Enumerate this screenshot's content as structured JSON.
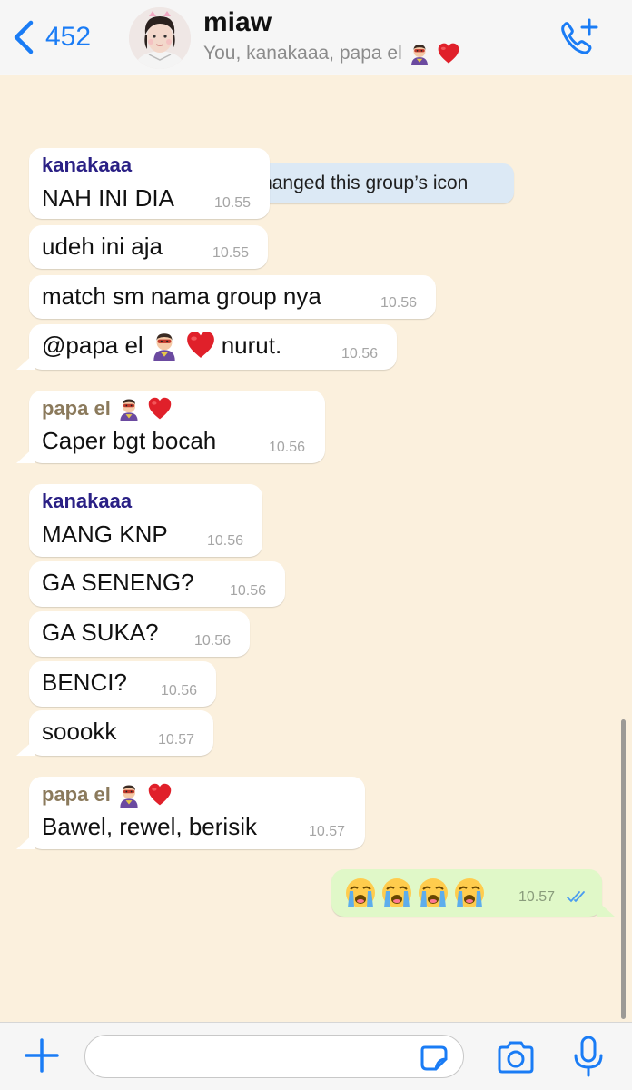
{
  "header": {
    "back_count": "452",
    "title": "miaw",
    "subtitle": "You, kanakaaa, papa el"
  },
  "system_message": "kanakaaa changed this group’s icon",
  "messages": [
    {
      "sender": "kanakaaa",
      "text": "NAH INI DIA",
      "time": "10.55"
    },
    {
      "text": "udeh ini aja",
      "time": "10.55"
    },
    {
      "text": "match sm nama group nya",
      "time": "10.56"
    },
    {
      "text_before": "@papa el",
      "text_after": "nurut.",
      "time": "10.56"
    },
    {
      "sender": "papa el",
      "text": "Caper bgt bocah",
      "time": "10.56"
    },
    {
      "sender": "kanakaaa",
      "text": "MANG KNP",
      "time": "10.56"
    },
    {
      "text": "GA SENENG?",
      "time": "10.56"
    },
    {
      "text": "GA SUKA?",
      "time": "10.56"
    },
    {
      "text": "BENCI?",
      "time": "10.56"
    },
    {
      "text": "soookk",
      "time": "10.57"
    },
    {
      "sender": "papa el",
      "text": "Bawel, rewel, berisik",
      "time": "10.57"
    }
  ],
  "outgoing": {
    "emojis": [
      "crying-face",
      "crying-face",
      "crying-face",
      "crying-face"
    ],
    "time": "10.57",
    "status": "read"
  },
  "input": {
    "placeholder": "",
    "value": ""
  },
  "icons": {
    "back": "chevron-left-icon",
    "call": "phone-plus-icon",
    "attach": "plus-icon",
    "sticker": "sticker-icon",
    "camera": "camera-icon",
    "mic": "microphone-icon"
  },
  "colors": {
    "accent": "#1a7cf5",
    "chat_background": "#fbf0dd",
    "outgoing_bubble": "#e0f8c8",
    "system_bubble": "#dce9f5",
    "sender_kanakaaa": "#2a2085",
    "sender_papa_el": "#8b7a5c"
  }
}
